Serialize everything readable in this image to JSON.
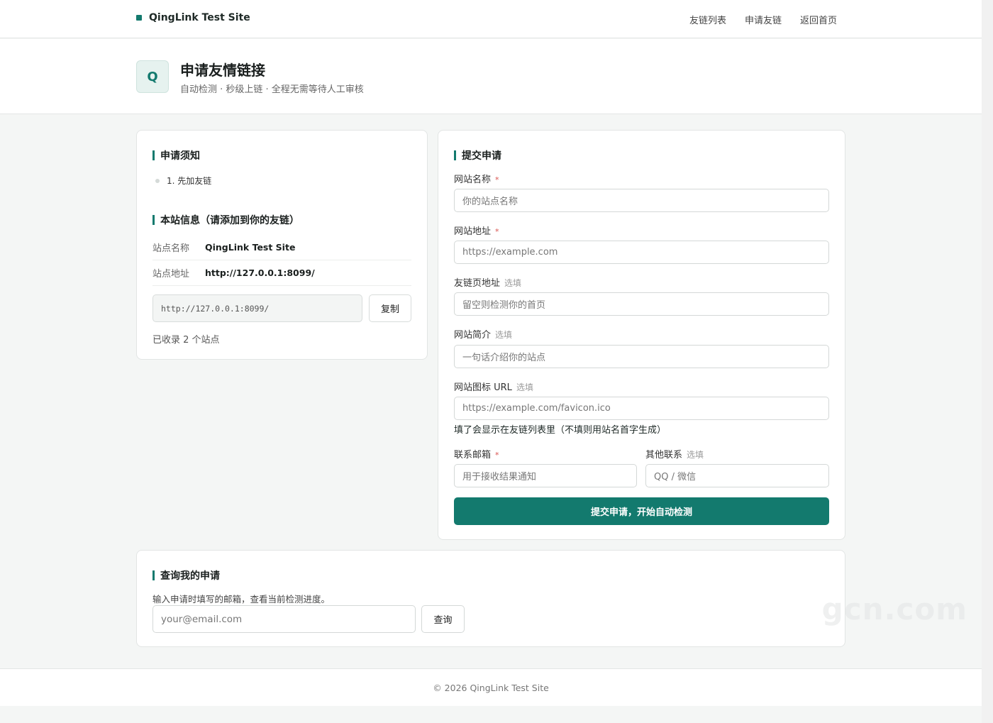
{
  "nav": {
    "brand": "QingLink Test Site",
    "links": [
      "友链列表",
      "申请友链",
      "返回首页"
    ]
  },
  "hero": {
    "logo_letter": "Q",
    "title": "申请友情链接",
    "subtitle": "自动检测 · 秒级上链 · 全程无需等待人工审核"
  },
  "notice": {
    "title": "申请须知",
    "items": [
      "1. 先加友链"
    ]
  },
  "site_info": {
    "title": "本站信息（请添加到你的友链）",
    "rows": [
      {
        "key": "站点名称",
        "value": "QingLink Test Site"
      },
      {
        "key": "站点地址",
        "value": "http://127.0.0.1:8099/"
      }
    ],
    "code": "http://127.0.0.1:8099/",
    "copy_label": "复制",
    "count_text": "已收录 2 个站点"
  },
  "form": {
    "title": "提交申请",
    "required_mark": "*",
    "optional_mark": "选填",
    "fields": [
      {
        "label": "网站名称",
        "placeholder": "你的站点名称"
      },
      {
        "label": "网站地址",
        "placeholder": "https://example.com"
      },
      {
        "label": "友链页地址",
        "placeholder": "留空则检测你的首页"
      },
      {
        "label": "网站简介",
        "placeholder": "一句话介绍你的站点"
      },
      {
        "label": "网站图标 URL",
        "placeholder": "https://example.com/favicon.ico"
      }
    ],
    "icon_hint": "填了会显示在友链列表里（不填则用站名首字生成）",
    "email": {
      "label": "联系邮箱",
      "placeholder": "用于接收结果通知"
    },
    "other": {
      "label": "其他联系",
      "placeholder": "QQ / 微信"
    },
    "submit_label": "提交申请，开始自动检测"
  },
  "query": {
    "title": "查询我的申请",
    "description": "输入申请时填写的邮箱，查看当前检测进度。",
    "placeholder": "your@email.com",
    "button_label": "查询"
  },
  "footer": {
    "text": "© 2026 QingLink Test Site"
  },
  "watermark": {
    "text": "gcn.com"
  },
  "colors": {
    "accent": "#137a6e",
    "required": "#d9534f"
  }
}
